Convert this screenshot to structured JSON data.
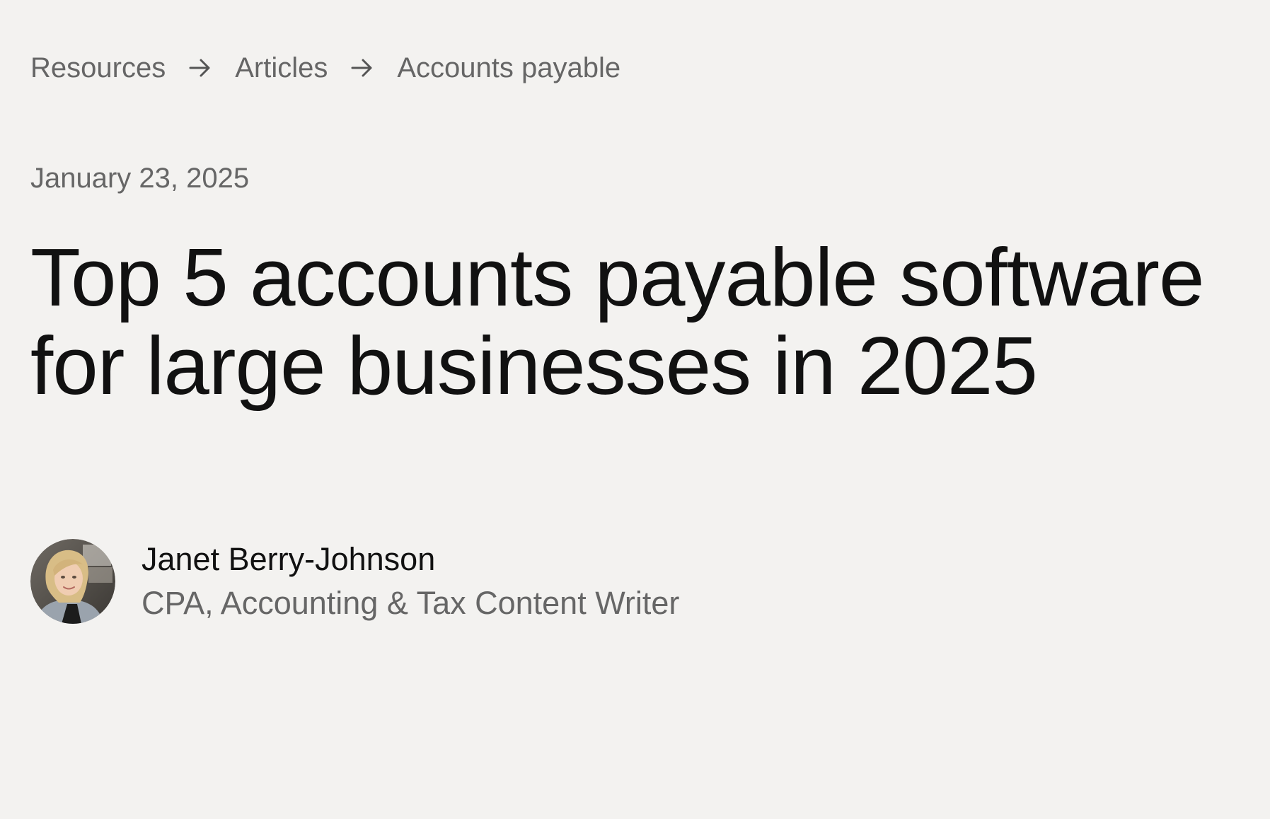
{
  "breadcrumb": {
    "items": [
      {
        "label": "Resources"
      },
      {
        "label": "Articles"
      },
      {
        "label": "Accounts payable"
      }
    ],
    "separator_icon": "arrow-right-icon"
  },
  "article": {
    "date": "January 23, 2025",
    "title": "Top 5 accounts payable software for large businesses in 2025"
  },
  "author": {
    "name": "Janet Berry-Johnson",
    "role": "CPA, Accounting & Tax Content Writer",
    "avatar_icon": "author-avatar"
  },
  "colors": {
    "background": "#f3f2f0",
    "text_primary": "#111111",
    "text_secondary": "#666666"
  }
}
